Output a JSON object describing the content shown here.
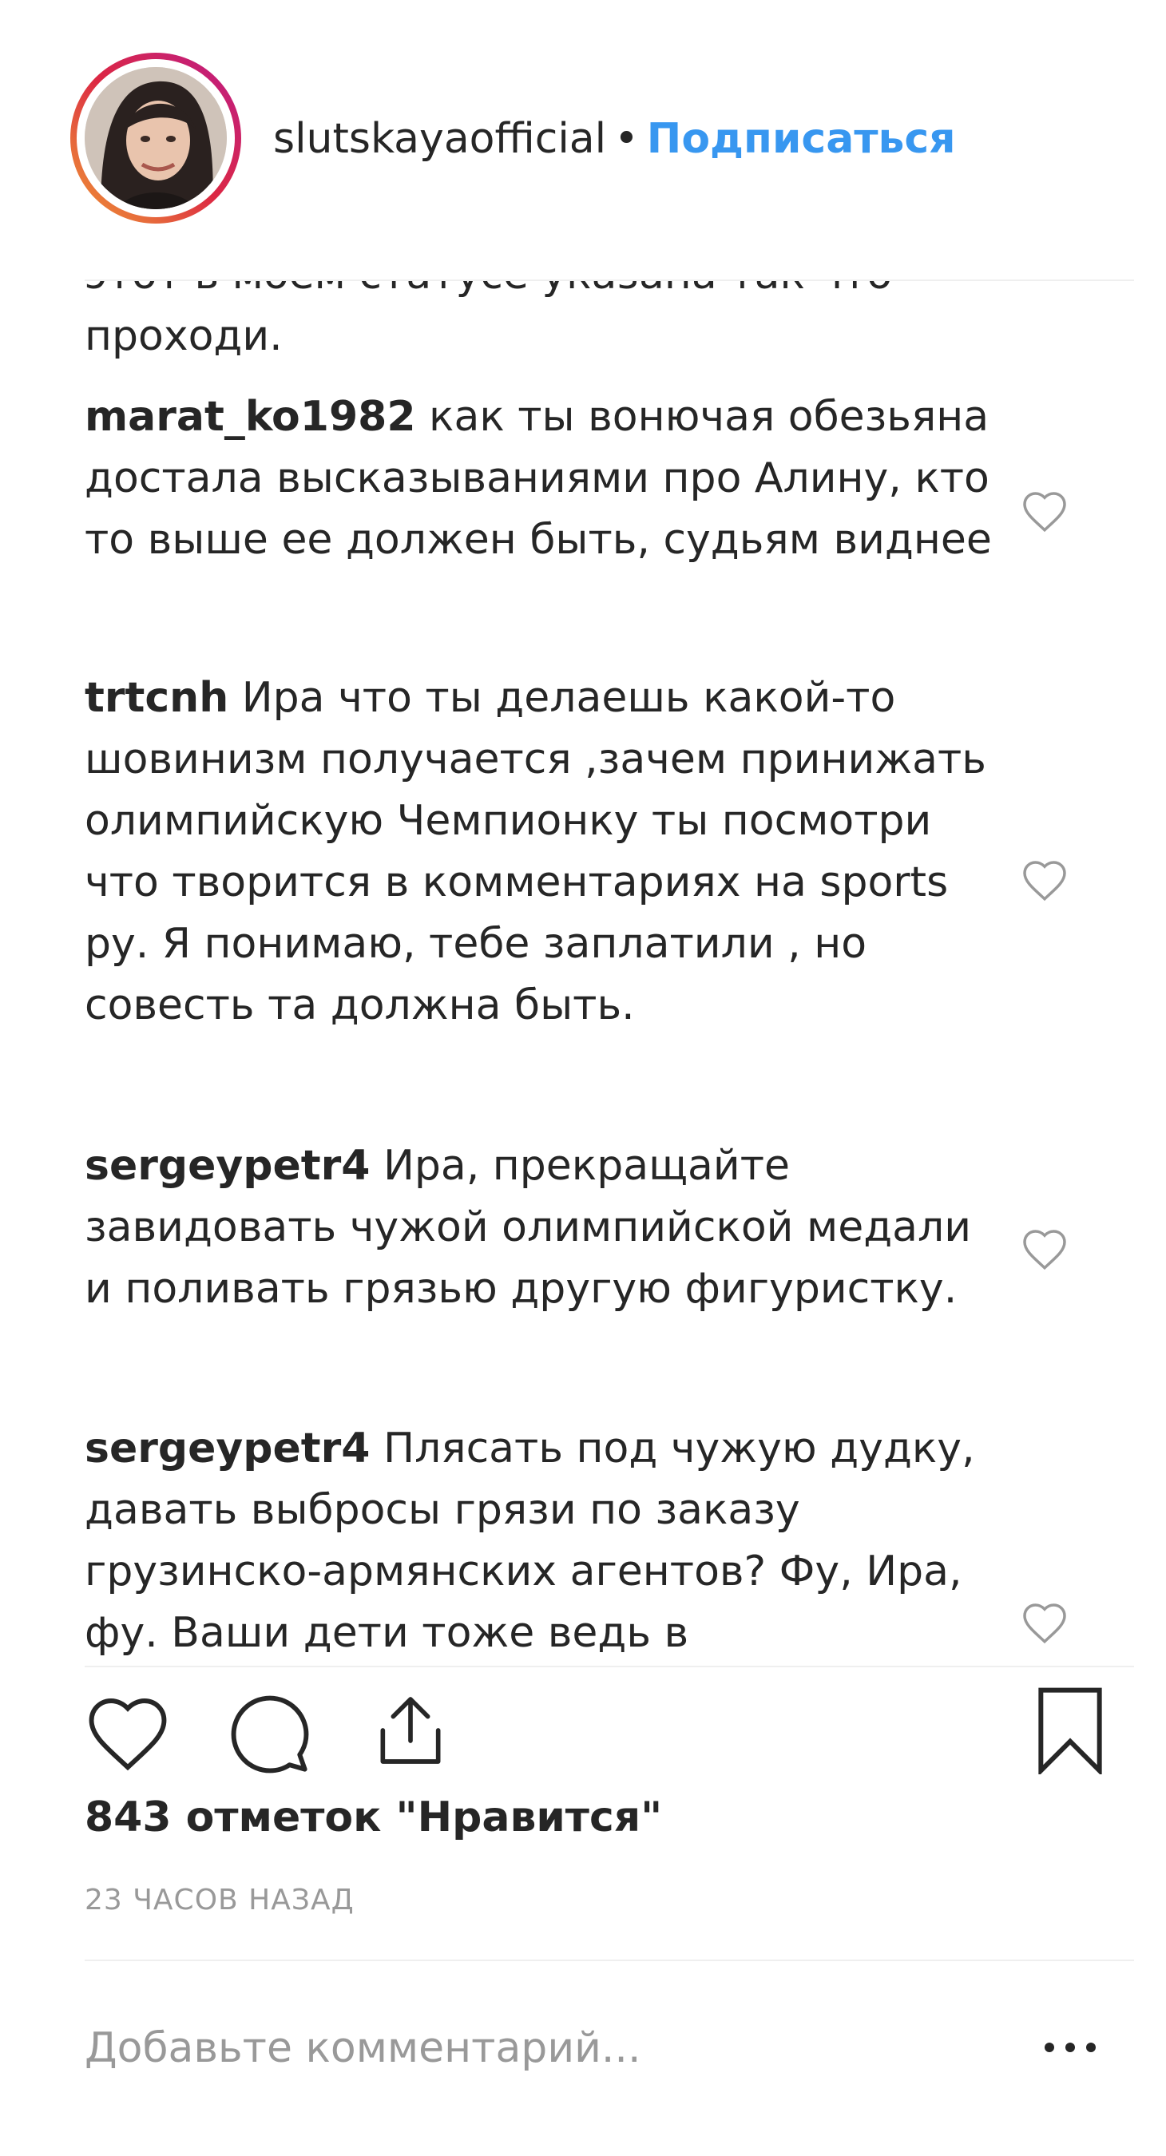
{
  "header": {
    "username": "slutskayaofficial",
    "separator": "•",
    "follow_label": "Подписаться"
  },
  "comments": [
    {
      "user": "",
      "text": "этот в моем статусе указана так что проходи.",
      "clipped": true
    },
    {
      "user": "marat_ko1982",
      "text": "как ты вонючая обезьяна достала высказываниями про Алину, кто то выше ее должен быть, судьям виднее"
    },
    {
      "user": "trtcnh",
      "text": "Ира что ты делаешь какой-то шовинизм получается ,зачем принижать олимпийскую Чемпионку ты посмотри что творится в комментариях на sports ру. Я понимаю, тебе заплатили , но совесть та должна быть."
    },
    {
      "user": "sergeypetr4",
      "text": "Ира, прекращайте завидовать чужой олимпийской медали и поливать грязью другую фигуристку."
    },
    {
      "user": "sergeypetr4",
      "text": "Плясать под чужую дудку, давать выбросы грязи по заказу грузинско-армянских агентов? Фу, Ира, фу. Ваши дети тоже ведь в"
    }
  ],
  "actions": {
    "like_icon": "heart-outline-icon",
    "comment_icon": "speech-bubble-icon",
    "share_icon": "share-upload-icon",
    "save_icon": "bookmark-icon"
  },
  "likes_text": "843 отметок \"Нравится\"",
  "time_text": "23 ЧАСОВ НАЗАД",
  "comment_input": {
    "placeholder": "Добавьте комментарий..."
  },
  "colors": {
    "accent": "#3897f0",
    "text": "#262626",
    "muted": "#999999",
    "divider": "#efefef"
  }
}
